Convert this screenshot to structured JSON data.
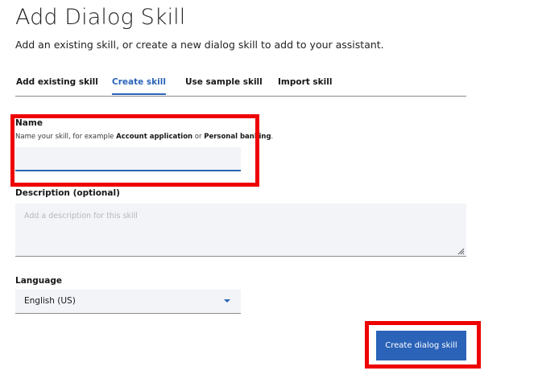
{
  "header": {
    "title": "Add Dialog Skill",
    "subtitle": "Add an existing skill, or create a new dialog skill to add to your assistant."
  },
  "tabs": [
    {
      "label": "Add existing skill",
      "active": false
    },
    {
      "label": "Create skill",
      "active": true
    },
    {
      "label": "Use sample skill",
      "active": false
    },
    {
      "label": "Import skill",
      "active": false
    }
  ],
  "form": {
    "name": {
      "label": "Name",
      "helper_prefix": "Name your skill, for example ",
      "helper_example1": "Account application",
      "helper_middle": " or ",
      "helper_example2": "Personal banking",
      "helper_suffix": ".",
      "value": ""
    },
    "description": {
      "label": "Description (optional)",
      "placeholder": "Add a description for this skill",
      "value": ""
    },
    "language": {
      "label": "Language",
      "selected": "English (US)"
    },
    "submit_label": "Create dialog skill"
  },
  "colors": {
    "accent": "#2a63b8",
    "highlight": "#ee0000",
    "field_bg": "#f2f4f8"
  },
  "icons": {
    "dropdown": "chevron-down-icon",
    "resize": "resize-handle-icon"
  }
}
